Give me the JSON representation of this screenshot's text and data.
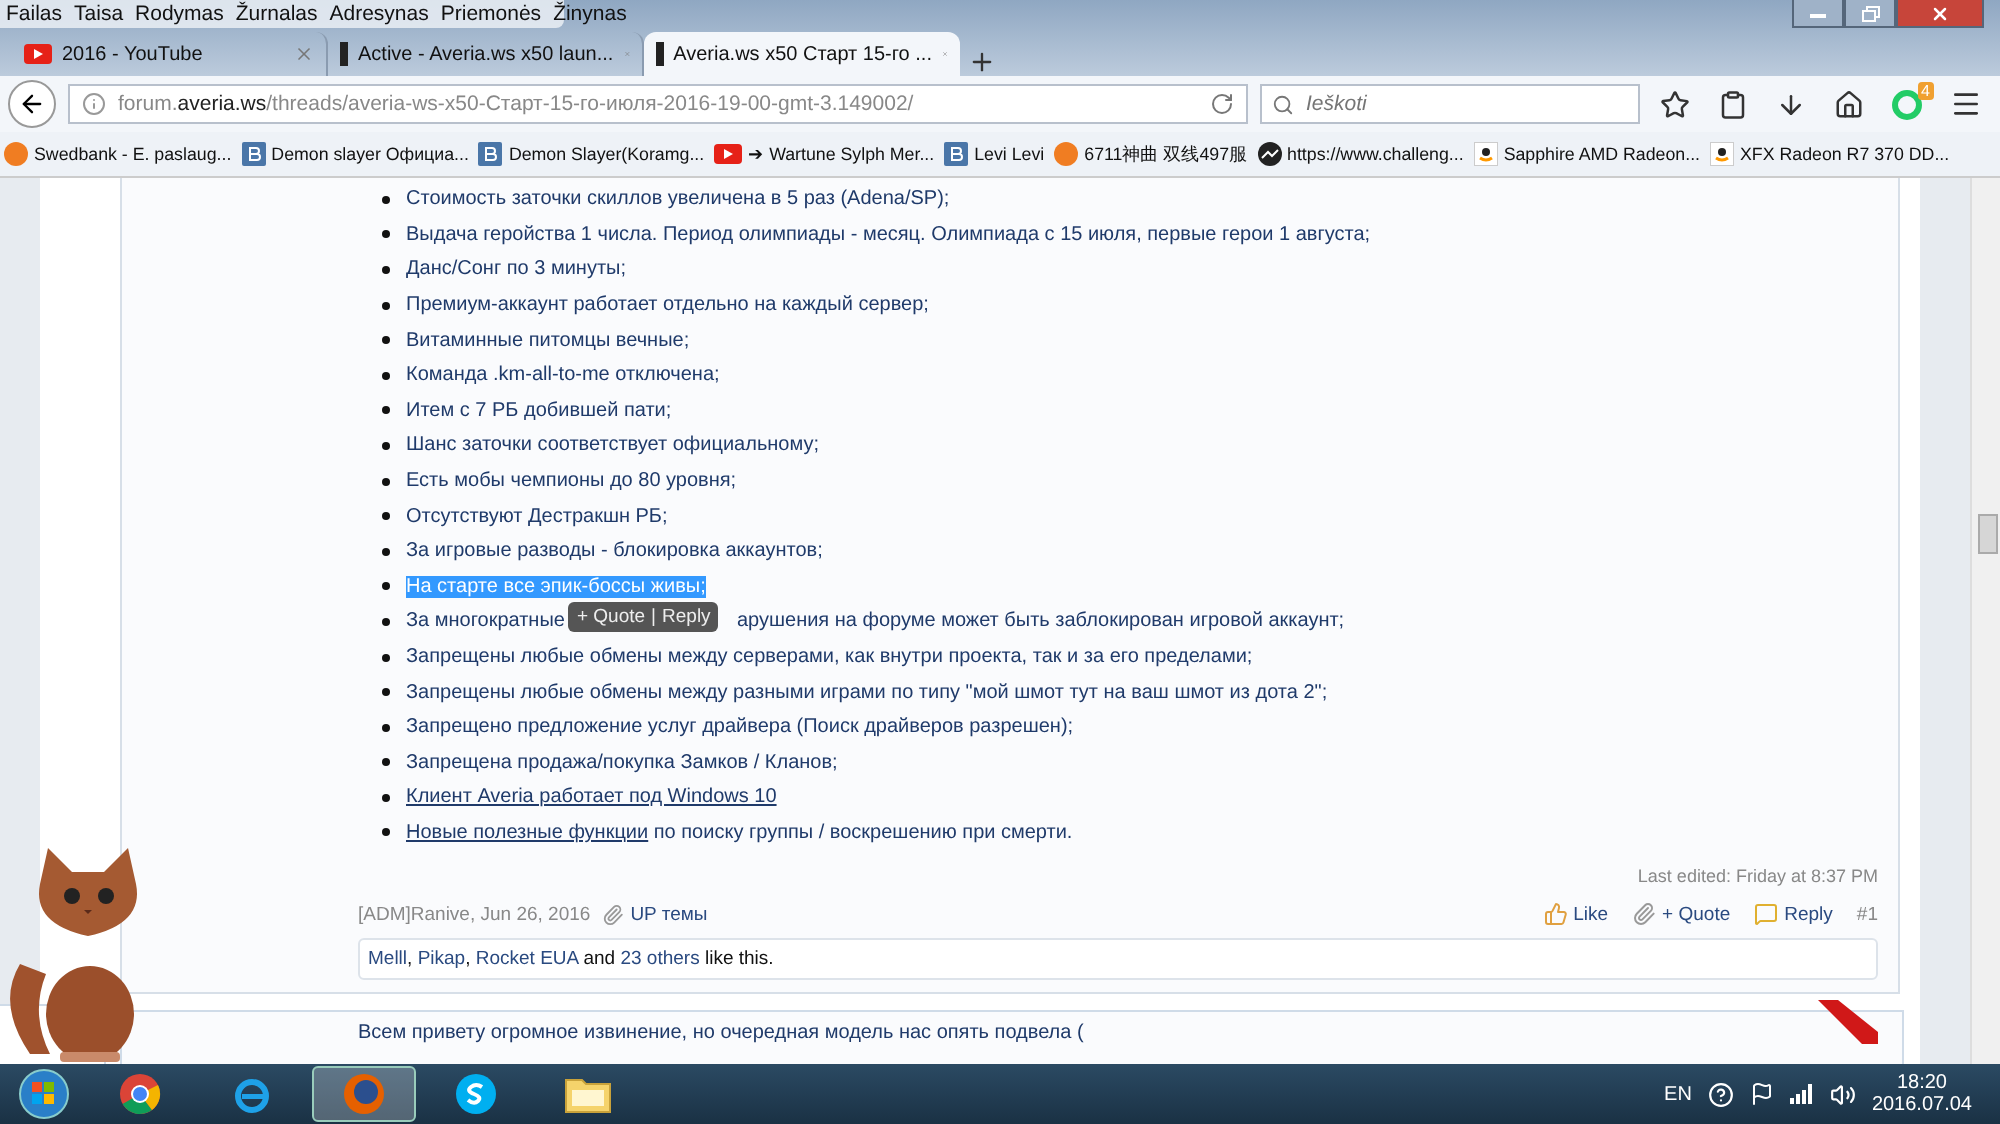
{
  "menu": [
    "Failas",
    "Taisa",
    "Rodymas",
    "Žurnalas",
    "Adresynas",
    "Priemonės",
    "Žinynas"
  ],
  "tabs": [
    {
      "title": "2016 - YouTube",
      "kind": "video",
      "selected": false
    },
    {
      "title": "Active - Averia.ws x50 laun...",
      "kind": "site",
      "selected": false
    },
    {
      "title": "Averia.ws x50 Старт 15-го ...",
      "kind": "site",
      "selected": true
    }
  ],
  "address": {
    "prefix": "forum.",
    "domain": "averia.ws",
    "path": "/threads/averia-ws-x50-Старт-15-го-июля-2016-19-00-gmt-3.149002/"
  },
  "search": {
    "placeholder": "Ieškoti"
  },
  "addon_badge": "4",
  "bookmarks": [
    {
      "label": "Swedbank - E. paslaug...",
      "kind": "orb"
    },
    {
      "label": "Demon slayer Официа...",
      "kind": "letter"
    },
    {
      "label": "Demon Slayer(Koramg...",
      "kind": "letter"
    },
    {
      "label": "➔ Wartune Sylph Mer...",
      "kind": "video"
    },
    {
      "label": "Levi Levi",
      "kind": "letter"
    },
    {
      "label": "6711神曲 双线497服",
      "kind": "orb"
    },
    {
      "label": "https://www.challeng...",
      "kind": "chart"
    },
    {
      "label": "Sapphire AMD Radeon...",
      "kind": "smile"
    },
    {
      "label": "XFX Radeon R7 370 DD...",
      "kind": "smile"
    }
  ],
  "post": {
    "items": [
      {
        "selected": false,
        "text": "Стоимость заточки скиллов увеличена в 5 раз (Adena/SP);"
      },
      {
        "selected": false,
        "text": "Выдача геройства 1 числа. Период олимпиады - месяц. Олимпиада с 15 июля, первые герои 1 августа;"
      },
      {
        "selected": false,
        "text": "Данс/Сонг по 3 минуты;"
      },
      {
        "selected": false,
        "text": "Премиум-аккаунт работает отдельно на каждый сервер;"
      },
      {
        "selected": false,
        "text": "Витаминные питомцы вечные;"
      },
      {
        "selected": false,
        "text": "Команда .km-all-to-me отключена;"
      },
      {
        "selected": false,
        "text": "Итем с 7 РБ добившей пати;"
      },
      {
        "selected": false,
        "text": "Шанс заточки соответствует официальному;"
      },
      {
        "selected": false,
        "text": "Есть мобы чемпионы до 80 уровня;"
      },
      {
        "selected": false,
        "text": "Отсутствуют Дестракшн РБ;"
      },
      {
        "selected": false,
        "text": "За игровые разводы - блокировка аккаунтов;"
      },
      {
        "selected": true,
        "text": "На старте все эпик-боссы живы;"
      },
      {
        "selected": false,
        "text": "За многократные",
        "continued": "арушения на форуме может быть заблокирован игровой аккаунт;"
      },
      {
        "selected": false,
        "text": "Запрещены любые обмены между серверами, как внутри проекта, так и за его пределами;"
      },
      {
        "selected": false,
        "text": "Запрещены любые обмены между разными играми по типу \"мой шмот тут на ваш шмот из дота 2\";"
      },
      {
        "selected": false,
        "text": "Запрещено предложение услуг драйвера (Поиск драйверов разрешен);"
      },
      {
        "selected": false,
        "text": "Запрещена продажа/покупка Замков / Кланов;"
      },
      {
        "selected": false,
        "link": "Клиент Averia работает под Windows 10"
      },
      {
        "selected": false,
        "link": "Новые полезные функции",
        "text": " по поиску группы / воскрешению при смерти."
      }
    ],
    "popup": {
      "quote": "+ Quote",
      "separator": "|",
      "reply": "Reply"
    },
    "last_edited": "Last edited: Friday at 8:37 PM",
    "author_date": "[ADM]Ranive, Jun 26, 2016",
    "up_link": "UP темы",
    "actions": {
      "like": "Like",
      "quote": "+ Quote",
      "reply": "Reply",
      "number": "#1"
    },
    "likes": [
      {
        "name": "Melll",
        "after": ","
      },
      {
        "name": "Pikap",
        "after": ","
      },
      {
        "name": "Rocket EUA",
        "after": " and"
      },
      {
        "name": "23 others",
        "after": " like this."
      }
    ]
  },
  "next_post": "Всем привету огромное извинение, но очередная модель нас опять подвела (",
  "taskbar": {
    "apps": [
      {
        "kind": "chrome",
        "active": false
      },
      {
        "kind": "ie",
        "active": false
      },
      {
        "kind": "firefox",
        "active": true
      },
      {
        "kind": "skype",
        "active": false
      },
      {
        "kind": "folder",
        "active": false
      }
    ],
    "language": "EN",
    "time": "18:20",
    "date": "2016.07.04"
  }
}
